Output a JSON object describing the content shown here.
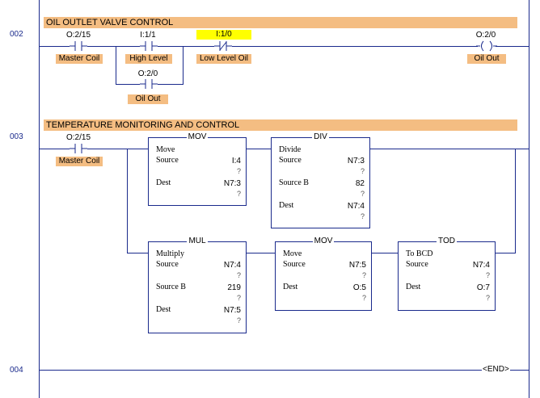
{
  "rungs": [
    {
      "number": "002",
      "comment": "OIL OUTLET VALVE CONTROL"
    },
    {
      "number": "003",
      "comment": "TEMPERATURE MONITORING AND CONTROL"
    },
    {
      "number": "004"
    }
  ],
  "rung002": {
    "master": {
      "addr": "O:2/15",
      "tag": "Master Coil"
    },
    "high": {
      "addr": "I:1/1",
      "tag": "High Level"
    },
    "branch": {
      "addr": "O:2/0",
      "tag": "Oil Out"
    },
    "low": {
      "addr": "I:1/0",
      "tag": "Low Level Oil"
    },
    "coil": {
      "addr": "O:2/0",
      "tag": "Oil Out"
    }
  },
  "rung003": {
    "master": {
      "addr": "O:2/15",
      "tag": "Master Coil"
    },
    "mov1": {
      "title": "MOV",
      "name": "Move",
      "source_label": "Source",
      "source": "I:4",
      "source_val": "?",
      "dest_label": "Dest",
      "dest": "N7:3",
      "dest_val": "?"
    },
    "div": {
      "title": "DIV",
      "name": "Divide",
      "source_label": "Source",
      "source": "N7:3",
      "source_val": "?",
      "sourceb_label": "Source B",
      "sourceb": "82",
      "sourceb_val": "?",
      "dest_label": "Dest",
      "dest": "N7:4",
      "dest_val": "?"
    },
    "mul": {
      "title": "MUL",
      "name": "Multiply",
      "source_label": "Source",
      "source": "N7:4",
      "source_val": "?",
      "sourceb_label": "Source B",
      "sourceb": "219",
      "sourceb_val": "?",
      "dest_label": "Dest",
      "dest": "N7:5",
      "dest_val": "?"
    },
    "mov2": {
      "title": "MOV",
      "name": "Move",
      "source_label": "Source",
      "source": "N7:5",
      "source_val": "?",
      "dest_label": "Dest",
      "dest": "O:5",
      "dest_val": "?"
    },
    "tod": {
      "title": "TOD",
      "name": "To BCD",
      "source_label": "Source",
      "source": "N7:4",
      "source_val": "?",
      "dest_label": "Dest",
      "dest": "O:7",
      "dest_val": "?"
    }
  },
  "rung004": {
    "end": "END"
  },
  "colors": {
    "wire": "#1a2a8c",
    "tag": "#f4bd82",
    "highlight": "#ffff00"
  }
}
